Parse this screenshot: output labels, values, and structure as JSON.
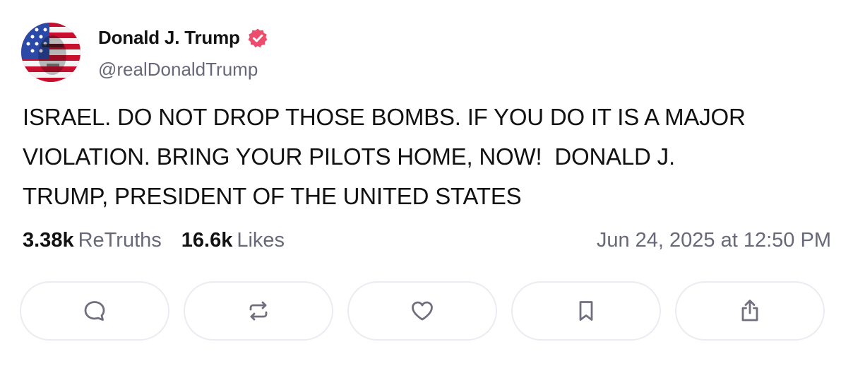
{
  "author": {
    "name": "Donald J. Trump",
    "handle": "@realDonaldTrump",
    "verified_icon": "verified-badge-icon",
    "badge_color": "#ee4c6c"
  },
  "post": {
    "text": "ISRAEL. DO NOT DROP THOSE BOMBS. IF YOU DO IT IS A MAJOR\nVIOLATION. BRING YOUR PILOTS HOME, NOW!  DONALD J.\nTRUMP, PRESIDENT OF THE UNITED STATES"
  },
  "stats": {
    "retruths_count": "3.38k",
    "retruths_label": "ReTruths",
    "likes_count": "16.6k",
    "likes_label": "Likes"
  },
  "timestamp": "Jun 24, 2025 at 12:50 PM",
  "actions": [
    {
      "name": "reply",
      "icon": "comment-icon"
    },
    {
      "name": "retruth",
      "icon": "repost-icon"
    },
    {
      "name": "like",
      "icon": "heart-icon"
    },
    {
      "name": "bookmark",
      "icon": "bookmark-icon"
    },
    {
      "name": "share",
      "icon": "share-icon"
    }
  ],
  "colors": {
    "icon_gray": "#6f6f7e",
    "border": "#ecebf1",
    "muted_text": "#676879"
  }
}
